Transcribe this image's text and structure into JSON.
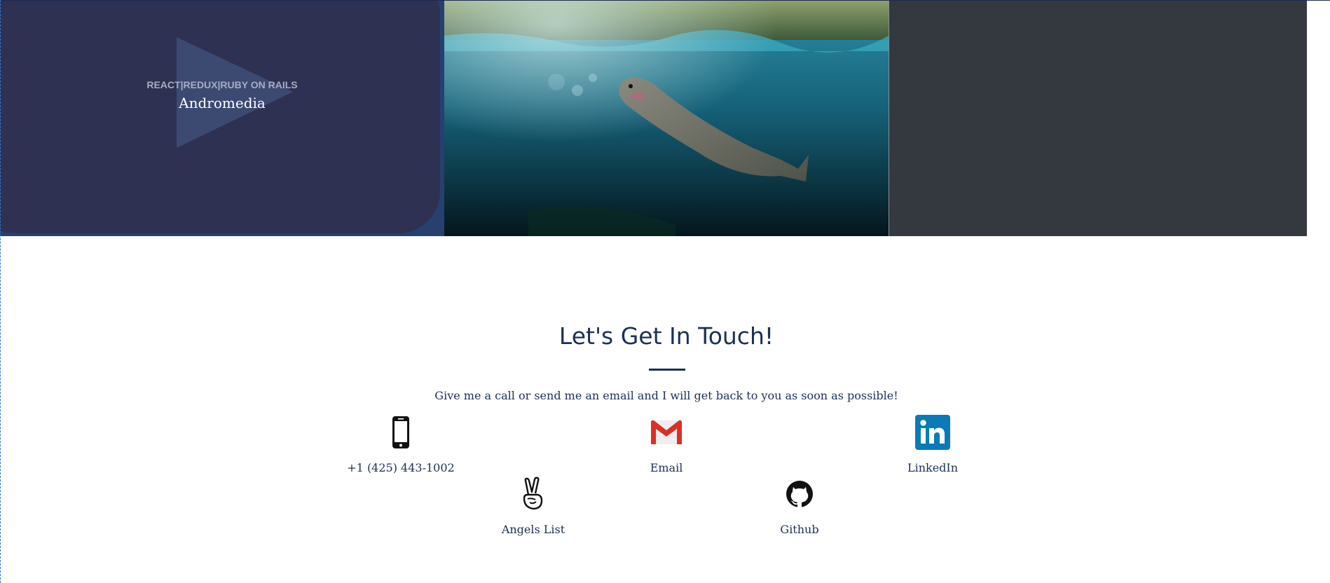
{
  "projects": [
    {
      "stack": "REACT|REDUX|RUBY ON RAILS",
      "name": "Andromedia"
    },
    {
      "image": "fish-underwater-photo"
    },
    {
      "image": "empty-dark-tile"
    }
  ],
  "contact": {
    "title": "Let's Get In Touch!",
    "subtitle": "Give me a call or send me an email and I will get back to you as soon as possible!",
    "items": [
      {
        "label": "+1 (425) 443-1002",
        "icon": "phone-icon"
      },
      {
        "label": "Email",
        "icon": "gmail-icon",
        "color": "#d93025"
      },
      {
        "label": "LinkedIn",
        "icon": "linkedin-icon",
        "color": "#0a7ab8"
      },
      {
        "label": "Angels List",
        "icon": "angellist-icon"
      },
      {
        "label": "Github",
        "icon": "github-icon"
      }
    ]
  },
  "colors": {
    "heading": "#1d3054",
    "tile_dark": "#33393f",
    "tile_navy": "#2e3152"
  }
}
